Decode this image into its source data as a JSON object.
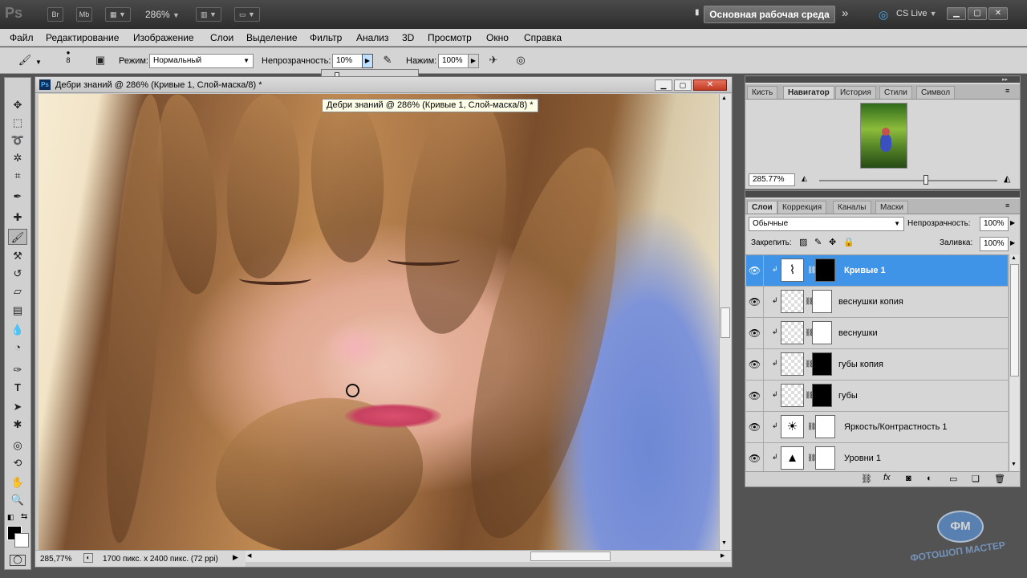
{
  "appbar": {
    "logo": "Ps",
    "br": "Br",
    "mb": "Mb",
    "zoom": "286%",
    "workspace": "Основная рабочая среда",
    "cslive": "CS Live"
  },
  "menu": [
    "Файл",
    "Редактирование",
    "Изображение",
    "Слои",
    "Выделение",
    "Фильтр",
    "Анализ",
    "3D",
    "Просмотр",
    "Окно",
    "Справка"
  ],
  "options": {
    "brush_size": "8",
    "mode_label": "Режим:",
    "mode_value": "Нормальный",
    "opacity_label": "Непрозрачность:",
    "opacity_value": "10%",
    "flow_label": "Нажим:",
    "flow_value": "100%"
  },
  "document": {
    "title": "Дебри знаний @ 286% (Кривые 1, Слой-маска/8) *",
    "tooltip": "Дебри знаний @ 286% (Кривые 1, Слой-маска/8) *",
    "zoom": "285,77%",
    "info": "1700 пикс. x 2400 пикс. (72 ppi)"
  },
  "navigator": {
    "tabs": [
      "Кисть",
      "Навигатор",
      "История",
      "Стили",
      "Символ"
    ],
    "active_tab": "Навигатор",
    "zoom": "285.77%"
  },
  "layers": {
    "tabs": [
      "Слои",
      "Коррекция",
      "Каналы",
      "Маски"
    ],
    "active_tab": "Слои",
    "blend_mode": "Обычные",
    "opacity_label": "Непрозрачность:",
    "opacity_value": "100%",
    "lock_label": "Закрепить:",
    "fill_label": "Заливка:",
    "fill_value": "100%",
    "items": [
      {
        "name": "Кривые 1",
        "selected": true
      },
      {
        "name": "веснушки копия",
        "selected": false
      },
      {
        "name": "веснушки",
        "selected": false
      },
      {
        "name": "губы копия",
        "selected": false
      },
      {
        "name": "губы",
        "selected": false
      },
      {
        "name": "Яркость/Контрастность 1",
        "selected": false
      },
      {
        "name": "Уровни 1",
        "selected": false
      }
    ]
  },
  "watermark": {
    "line1": "ФОТОШОП",
    "line2": "МАСТЕР"
  },
  "colors": {
    "selection": "#3f94e8",
    "panel": "#d6d6d6",
    "appbar": "#3a3a3a"
  }
}
